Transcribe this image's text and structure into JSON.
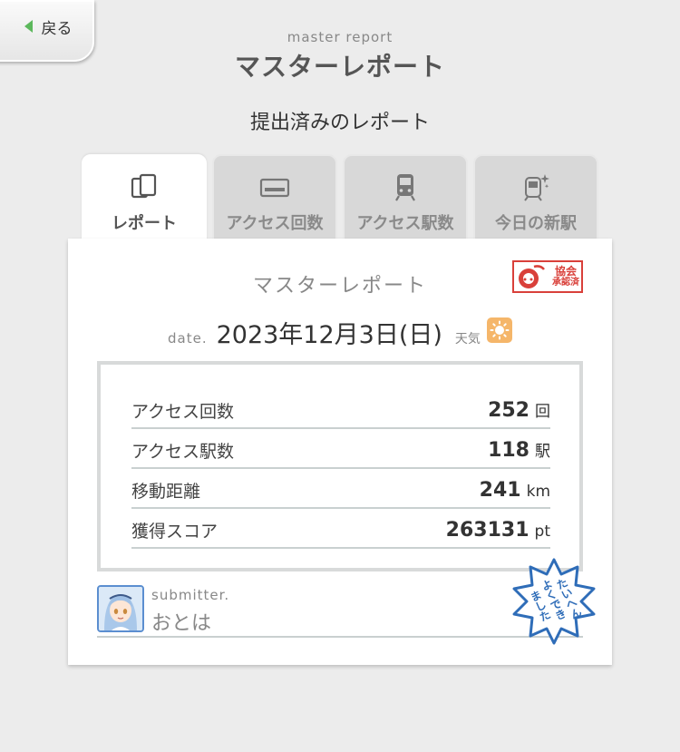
{
  "header": {
    "back_label": "戻る",
    "subtitle": "master report",
    "title": "マスターレポート"
  },
  "section_heading": "提出済みのレポート",
  "tabs": [
    {
      "label": "レポート",
      "icon": "report-icon",
      "active": true
    },
    {
      "label": "アクセス回数",
      "icon": "card-icon",
      "active": false
    },
    {
      "label": "アクセス駅数",
      "icon": "train-icon",
      "active": false
    },
    {
      "label": "今日の新駅",
      "icon": "new-station-icon",
      "active": false
    }
  ],
  "card": {
    "title": "マスターレポート",
    "stamp_kyokai": {
      "line1": "協会",
      "line2": "承認済"
    },
    "date_prefix": "date.",
    "date_value": "2023年12月3日(日)",
    "weather_label": "天気",
    "weather_icon": "sun-icon",
    "stats": [
      {
        "label": "アクセス回数",
        "value": "252",
        "unit": "回"
      },
      {
        "label": "アクセス駅数",
        "value": "118",
        "unit": "駅"
      },
      {
        "label": "移動距離",
        "value": "241",
        "unit": "km"
      },
      {
        "label": "獲得スコア",
        "value": "263131",
        "unit": "pt"
      }
    ],
    "submitter_label": "submitter.",
    "submitter_name": "おとは",
    "stamp_taihen": {
      "line1": "たいへん",
      "line2": "よくでき",
      "line3": "ました"
    }
  },
  "colors": {
    "background": "#ececec",
    "accent_green": "#5cb85c",
    "stamp_red": "#d9403a",
    "stamp_blue": "#2f6db8",
    "sun": "#f5b66a"
  }
}
